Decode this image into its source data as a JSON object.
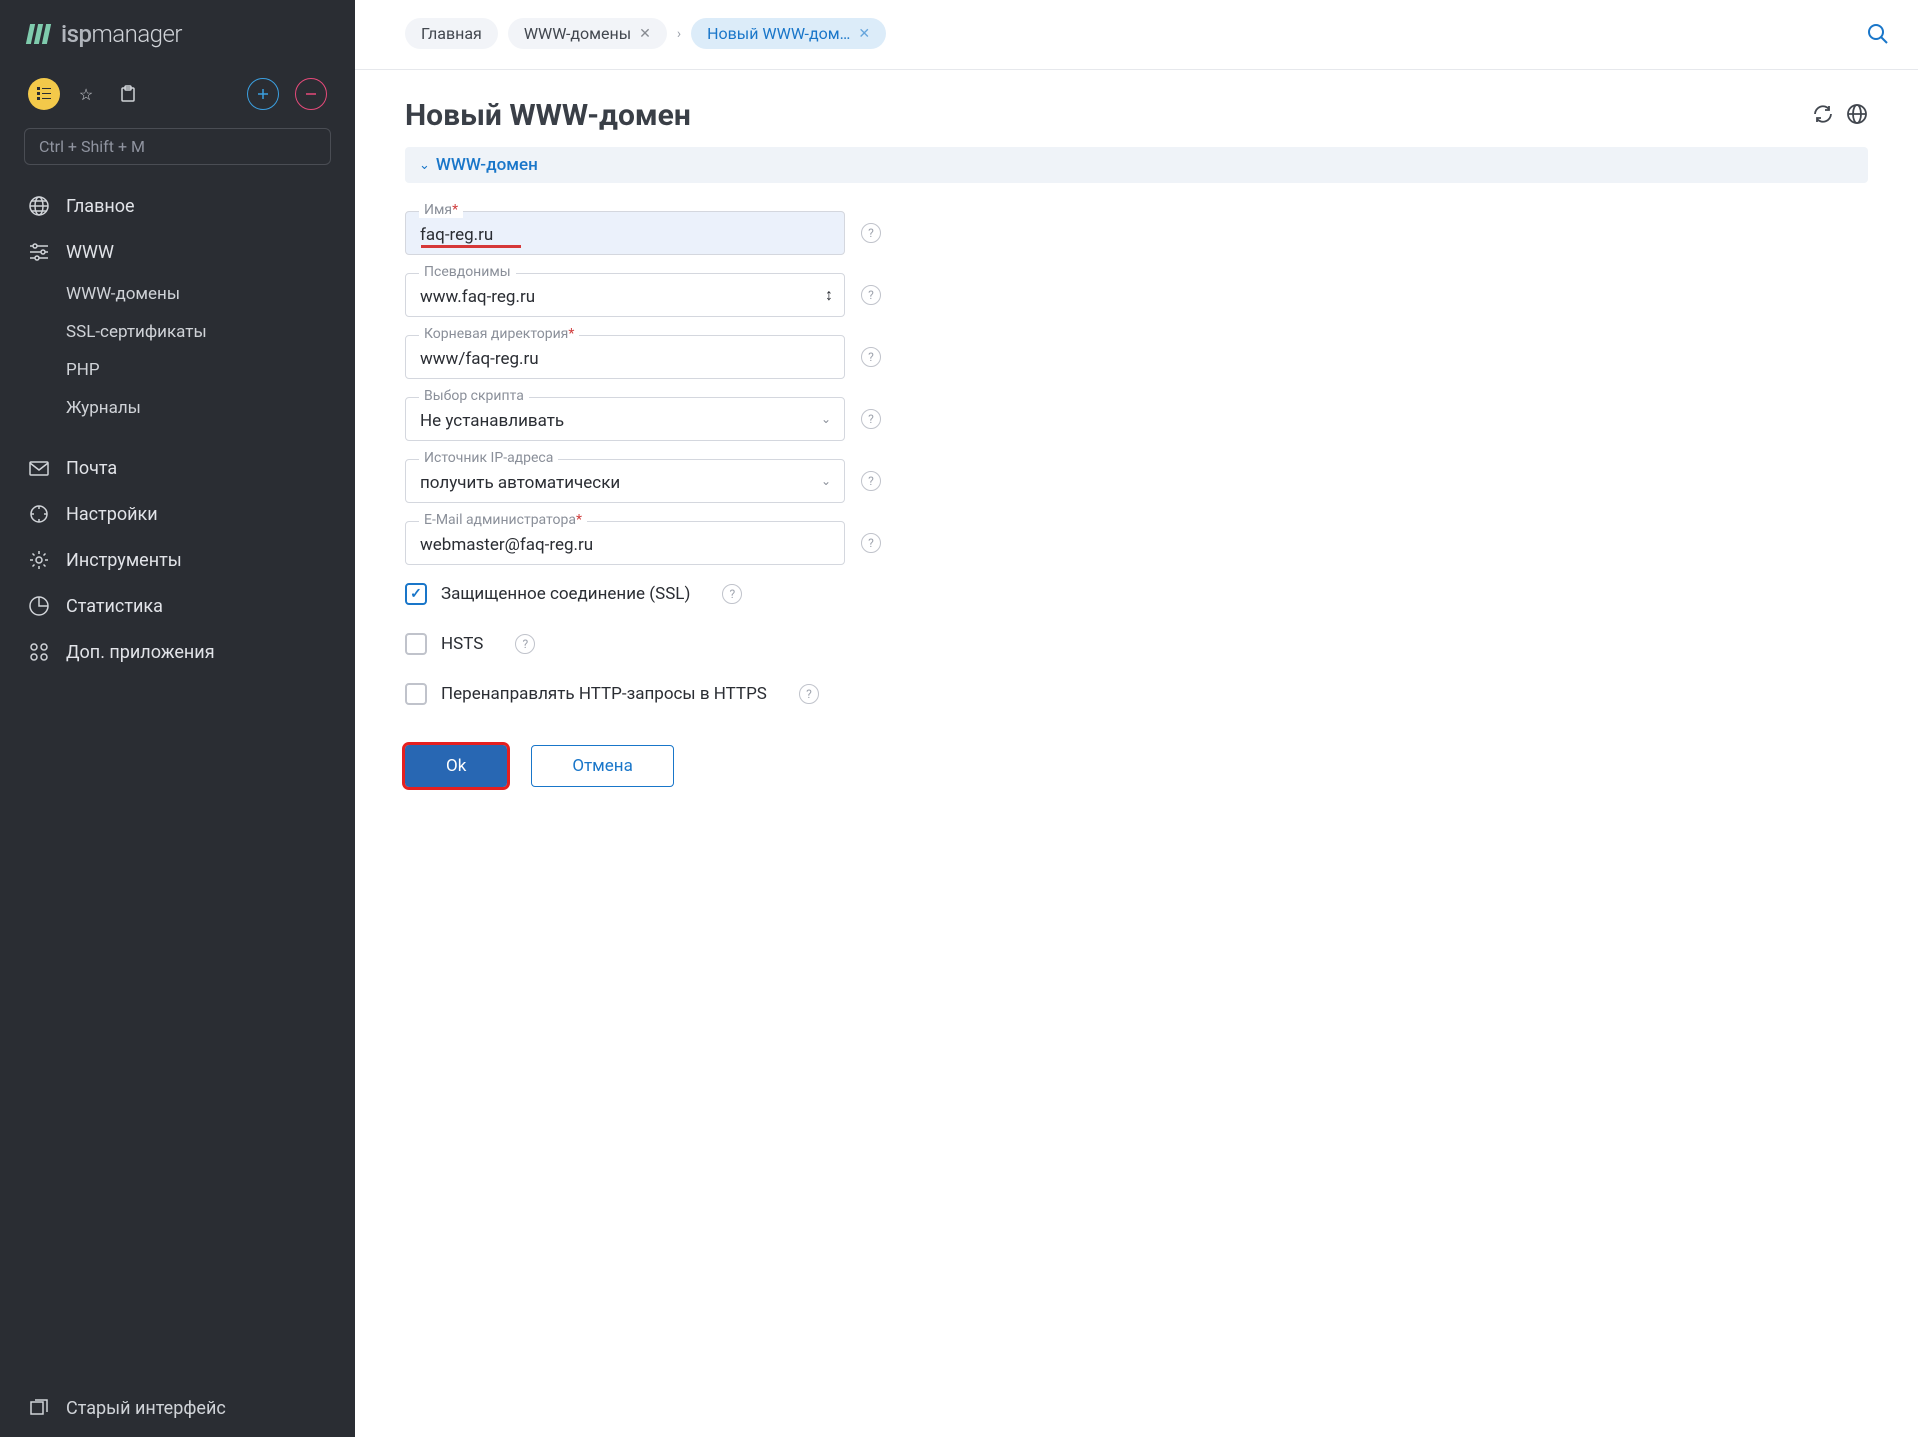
{
  "logo": {
    "prefix": "isp",
    "suffix": "manager"
  },
  "search_placeholder": "Ctrl + Shift + M",
  "menu": {
    "main": "Главное",
    "www": "WWW",
    "www_domains": "WWW-домены",
    "ssl": "SSL-сертификаты",
    "php": "PHP",
    "logs": "Журналы",
    "mail": "Почта",
    "settings": "Настройки",
    "tools": "Инструменты",
    "stats": "Статистика",
    "addons": "Доп. приложения"
  },
  "footer_link": "Старый интерфейс",
  "breadcrumbs": {
    "home": "Главная",
    "domains": "WWW-домены",
    "new": "Новый WWW-дом…"
  },
  "page_title": "Новый WWW-домен",
  "panel_title": "WWW-домен",
  "fields": {
    "name": {
      "label": "Имя",
      "value": "faq-reg.ru"
    },
    "aliases": {
      "label": "Псевдонимы",
      "value": "www.faq-reg.ru"
    },
    "root": {
      "label": "Корневая директория",
      "value": "www/faq-reg.ru"
    },
    "script": {
      "label": "Выбор скрипта",
      "value": "Не устанавливать"
    },
    "ip": {
      "label": "Источник IP-адреса",
      "value": "получить автоматически"
    },
    "email": {
      "label": "E-Mail администратора",
      "value": "webmaster@faq-reg.ru"
    }
  },
  "checkboxes": {
    "ssl": "Защищенное соединение (SSL)",
    "hsts": "HSTS",
    "redirect": "Перенаправлять HTTP-запросы в HTTPS"
  },
  "buttons": {
    "ok": "Ok",
    "cancel": "Отмена"
  }
}
